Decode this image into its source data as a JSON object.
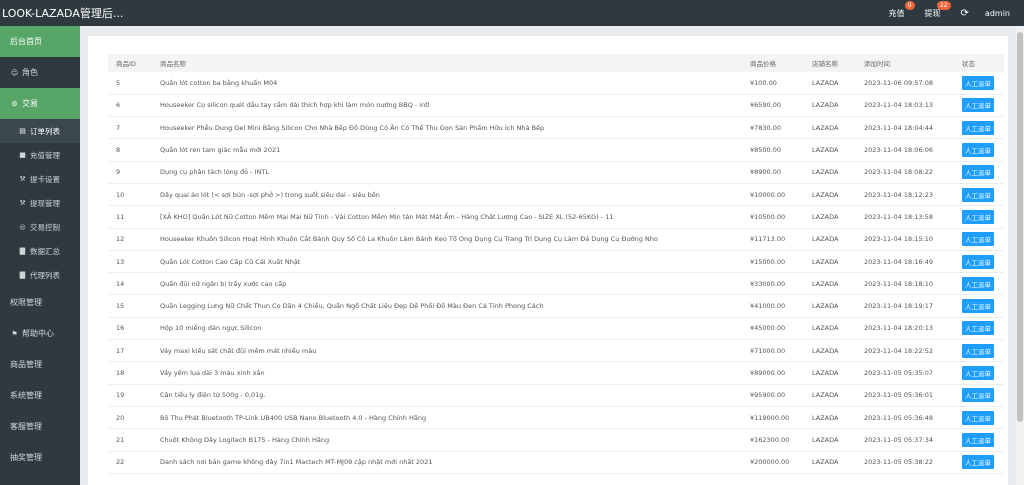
{
  "header": {
    "title": "LOOK-LAZADA管理后...",
    "recharge_label": "充值",
    "recharge_badge": "0",
    "withdraw_label": "提现",
    "withdraw_badge": "22",
    "refresh_icon": "refresh-icon",
    "user_label": "admin"
  },
  "sidebar": {
    "items": [
      {
        "label": "后台首页",
        "icon": ""
      },
      {
        "label": "角色",
        "icon": "user-icon"
      },
      {
        "label": "交易",
        "icon": "gear-icon"
      }
    ],
    "sub_items": [
      {
        "label": "订单列表",
        "icon": "cart-icon"
      },
      {
        "label": "充值管理",
        "icon": "card-icon"
      },
      {
        "label": "提卡设置",
        "icon": "wrench-icon"
      },
      {
        "label": "提现管理",
        "icon": "tool-icon"
      },
      {
        "label": "交易控制",
        "icon": "control-icon"
      },
      {
        "label": "数据汇总",
        "icon": "chart-icon"
      },
      {
        "label": "代理列表",
        "icon": "chart-icon"
      }
    ],
    "bottom_items": [
      {
        "label": "权限管理",
        "icon": ""
      },
      {
        "label": "帮助中心",
        "icon": "flag-icon"
      },
      {
        "label": "商品管理",
        "icon": ""
      },
      {
        "label": "系统管理",
        "icon": ""
      },
      {
        "label": "客服管理",
        "icon": ""
      },
      {
        "label": "抽奖管理",
        "icon": ""
      }
    ]
  },
  "table": {
    "columns": [
      "商品ID",
      "商品名称",
      "商品价格",
      "店铺名称",
      "添加时间",
      "状态"
    ],
    "rows": [
      {
        "id": "5",
        "name": "Quần lót cotton ba bằng khuẩn M04",
        "price": "¥100.00",
        "shop": "LAZADA",
        "time": "2023-11-06 09:57:08",
        "status": "人工派单"
      },
      {
        "id": "6",
        "name": "Houseeker Cọ silicon quét dầu tay cầm dài thích hợp khi làm món nướng BBQ - intl",
        "price": "¥6590.00",
        "shop": "LAZADA",
        "time": "2023-11-04 18:03:13",
        "status": "人工派单"
      },
      {
        "id": "7",
        "name": "Houseeker Phễu Dung Gel Mini Bằng Silicon Cho Nhà Bếp Đồ Dùng Có Ăn Có Thể Thu Gọn Sản Phẩm Hữu Ích Nhà Bếp",
        "price": "¥7830.00",
        "shop": "LAZADA",
        "time": "2023-11-04 18:04:44",
        "status": "人工派单"
      },
      {
        "id": "8",
        "name": "Quần lót ren tam giác mẫu mới 2021",
        "price": "¥8500.00",
        "shop": "LAZADA",
        "time": "2023-11-04 18:06:06",
        "status": "人工派单"
      },
      {
        "id": "9",
        "name": "Dụng cụ phân tách lòng đỏ - INTL",
        "price": "¥8900.00",
        "shop": "LAZADA",
        "time": "2023-11-04 18:08:22",
        "status": "人工派单"
      },
      {
        "id": "10",
        "name": "Dây quai áo lót (< sợi bún -sợi phở >) trong suốt siêu dai - siêu bền",
        "price": "¥10000.00",
        "shop": "LAZADA",
        "time": "2023-11-04 18:12:23",
        "status": "人工派单"
      },
      {
        "id": "11",
        "name": "[XẢ KHO] Quần Lót Nữ Cotton Mềm Mại Mại Nữ Tính - Vải Cotton Mềm Mịn tán Mát Mát Ẩm - Hàng Chất Lượng Cao - SIZE XL (52-65KG) - 11",
        "price": "¥10500.00",
        "shop": "LAZADA",
        "time": "2023-11-04 18:13:58",
        "status": "人工派单"
      },
      {
        "id": "12",
        "name": "Houseeker Khuôn Silicon Hoạt Hình Khuôn Cắt Bánh Quy Số Cô La Khuôn Làm Bánh Kẹo Tổ Ong Dụng Cụ Trang Trí Dụng Cụ Làm Đá Dụng Cụ Đường Nho",
        "price": "¥11713.00",
        "shop": "LAZADA",
        "time": "2023-11-04 18:15:10",
        "status": "人工派单"
      },
      {
        "id": "13",
        "name": "Quần Lót Cotton Cao Cấp Cũ Cái Xuất Nhật",
        "price": "¥15000.00",
        "shop": "LAZADA",
        "time": "2023-11-04 18:16:49",
        "status": "人工派单"
      },
      {
        "id": "14",
        "name": "Quần đùi nữ ngăn bị trầy xước cao cấp",
        "price": "¥33000.00",
        "shop": "LAZADA",
        "time": "2023-11-04 18:18:10",
        "status": "人工派单"
      },
      {
        "id": "15",
        "name": "Quần Legging Lưng Nữ Chất Thun Co Dãn 4 Chiều, Quần Ngố Chất Liệu Đẹp Dễ Phối Đồ Màu Đen Cá Tính Phong Cách",
        "price": "¥41000.00",
        "shop": "LAZADA",
        "time": "2023-11-04 18:19:17",
        "status": "人工派单"
      },
      {
        "id": "16",
        "name": "Hộp 10 miếng dán ngực Silicon",
        "price": "¥45000.00",
        "shop": "LAZADA",
        "time": "2023-11-04 18:20:13",
        "status": "人工派单"
      },
      {
        "id": "17",
        "name": "Váy maxi kiểu sát chất đũi mềm mát nhiều màu",
        "price": "¥71000.00",
        "shop": "LAZADA",
        "time": "2023-11-04 18:22:52",
        "status": "人工派单"
      },
      {
        "id": "18",
        "name": "Váy yếm lụa dài 3 màu xinh xắn",
        "price": "¥89000.00",
        "shop": "LAZADA",
        "time": "2023-11-05 05:35:07",
        "status": "人工派单"
      },
      {
        "id": "19",
        "name": "Cân tiểu ly điện tử 500g - 0,01g.",
        "price": "¥95900.00",
        "shop": "LAZADA",
        "time": "2023-11-05 05:36:01",
        "status": "人工派单"
      },
      {
        "id": "20",
        "name": "Bộ Thu Phát Bluetooth TP-Link UB400 USB Nano Bluetooth 4.0 - Hàng Chính Hãng",
        "price": "¥119000.00",
        "shop": "LAZADA",
        "time": "2023-11-05 05:36:48",
        "status": "人工派单"
      },
      {
        "id": "21",
        "name": "Chuột Không Dây Logitech B175 - Hàng Chính Hãng",
        "price": "¥162300.00",
        "shop": "LAZADA",
        "time": "2023-11-05 05:37:34",
        "status": "人工派单"
      },
      {
        "id": "22",
        "name": "Danh sách nơi bán game không dây 7in1 Mactech MT-MJ09 cập nhật mới nhất 2021",
        "price": "¥200000.00",
        "shop": "LAZADA",
        "time": "2023-11-05 05:38:22",
        "status": "人工派单"
      }
    ]
  }
}
